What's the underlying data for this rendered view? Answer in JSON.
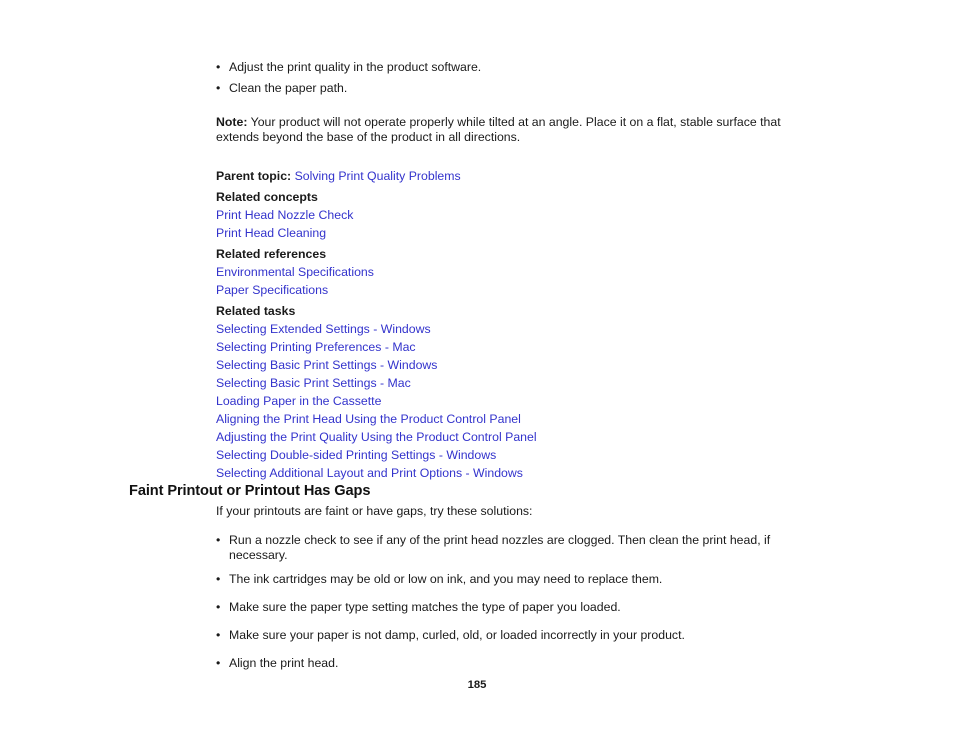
{
  "document": {
    "page_number": "185",
    "link_color": "#3333CC",
    "text_color": "#1A1A1A"
  },
  "top_section": {
    "bullets": [
      "Adjust the print quality in the product software.",
      "Clean the paper path."
    ],
    "note": {
      "label": "Note:",
      "text": "Your product will not operate properly while tilted at an angle. Place it on a flat, stable surface that extends beyond the base of the product in all directions."
    },
    "parent_topic": {
      "label": "Parent topic:",
      "link": "Solving Print Quality Problems"
    },
    "related_groups": [
      {
        "heading": "Related concepts",
        "links": [
          "Print Head Nozzle Check",
          "Print Head Cleaning"
        ]
      },
      {
        "heading": "Related references",
        "links": [
          "Environmental Specifications",
          "Paper Specifications"
        ]
      },
      {
        "heading": "Related tasks",
        "links": [
          "Selecting Extended Settings - Windows",
          "Selecting Printing Preferences - Mac",
          "Selecting Basic Print Settings - Windows",
          "Selecting Basic Print Settings - Mac",
          "Loading Paper in the Cassette",
          "Aligning the Print Head Using the Product Control Panel",
          "Adjusting the Print Quality Using the Product Control Panel",
          "Selecting Double-sided Printing Settings - Windows",
          "Selecting Additional Layout and Print Options - Windows"
        ]
      }
    ]
  },
  "faint_printout_section": {
    "heading": "Faint Printout or Printout Has Gaps",
    "intro": "If your printouts are faint or have gaps, try these solutions:",
    "bullets": [
      "Run a nozzle check to see if any of the print head nozzles are clogged. Then clean the print head, if necessary.",
      "The ink cartridges may be old or low on ink, and you may need to replace them.",
      "Make sure the paper type setting matches the type of paper you loaded.",
      "Make sure your paper is not damp, curled, old, or loaded incorrectly in your product.",
      "Align the print head."
    ]
  },
  "bullet_glyph": "•"
}
